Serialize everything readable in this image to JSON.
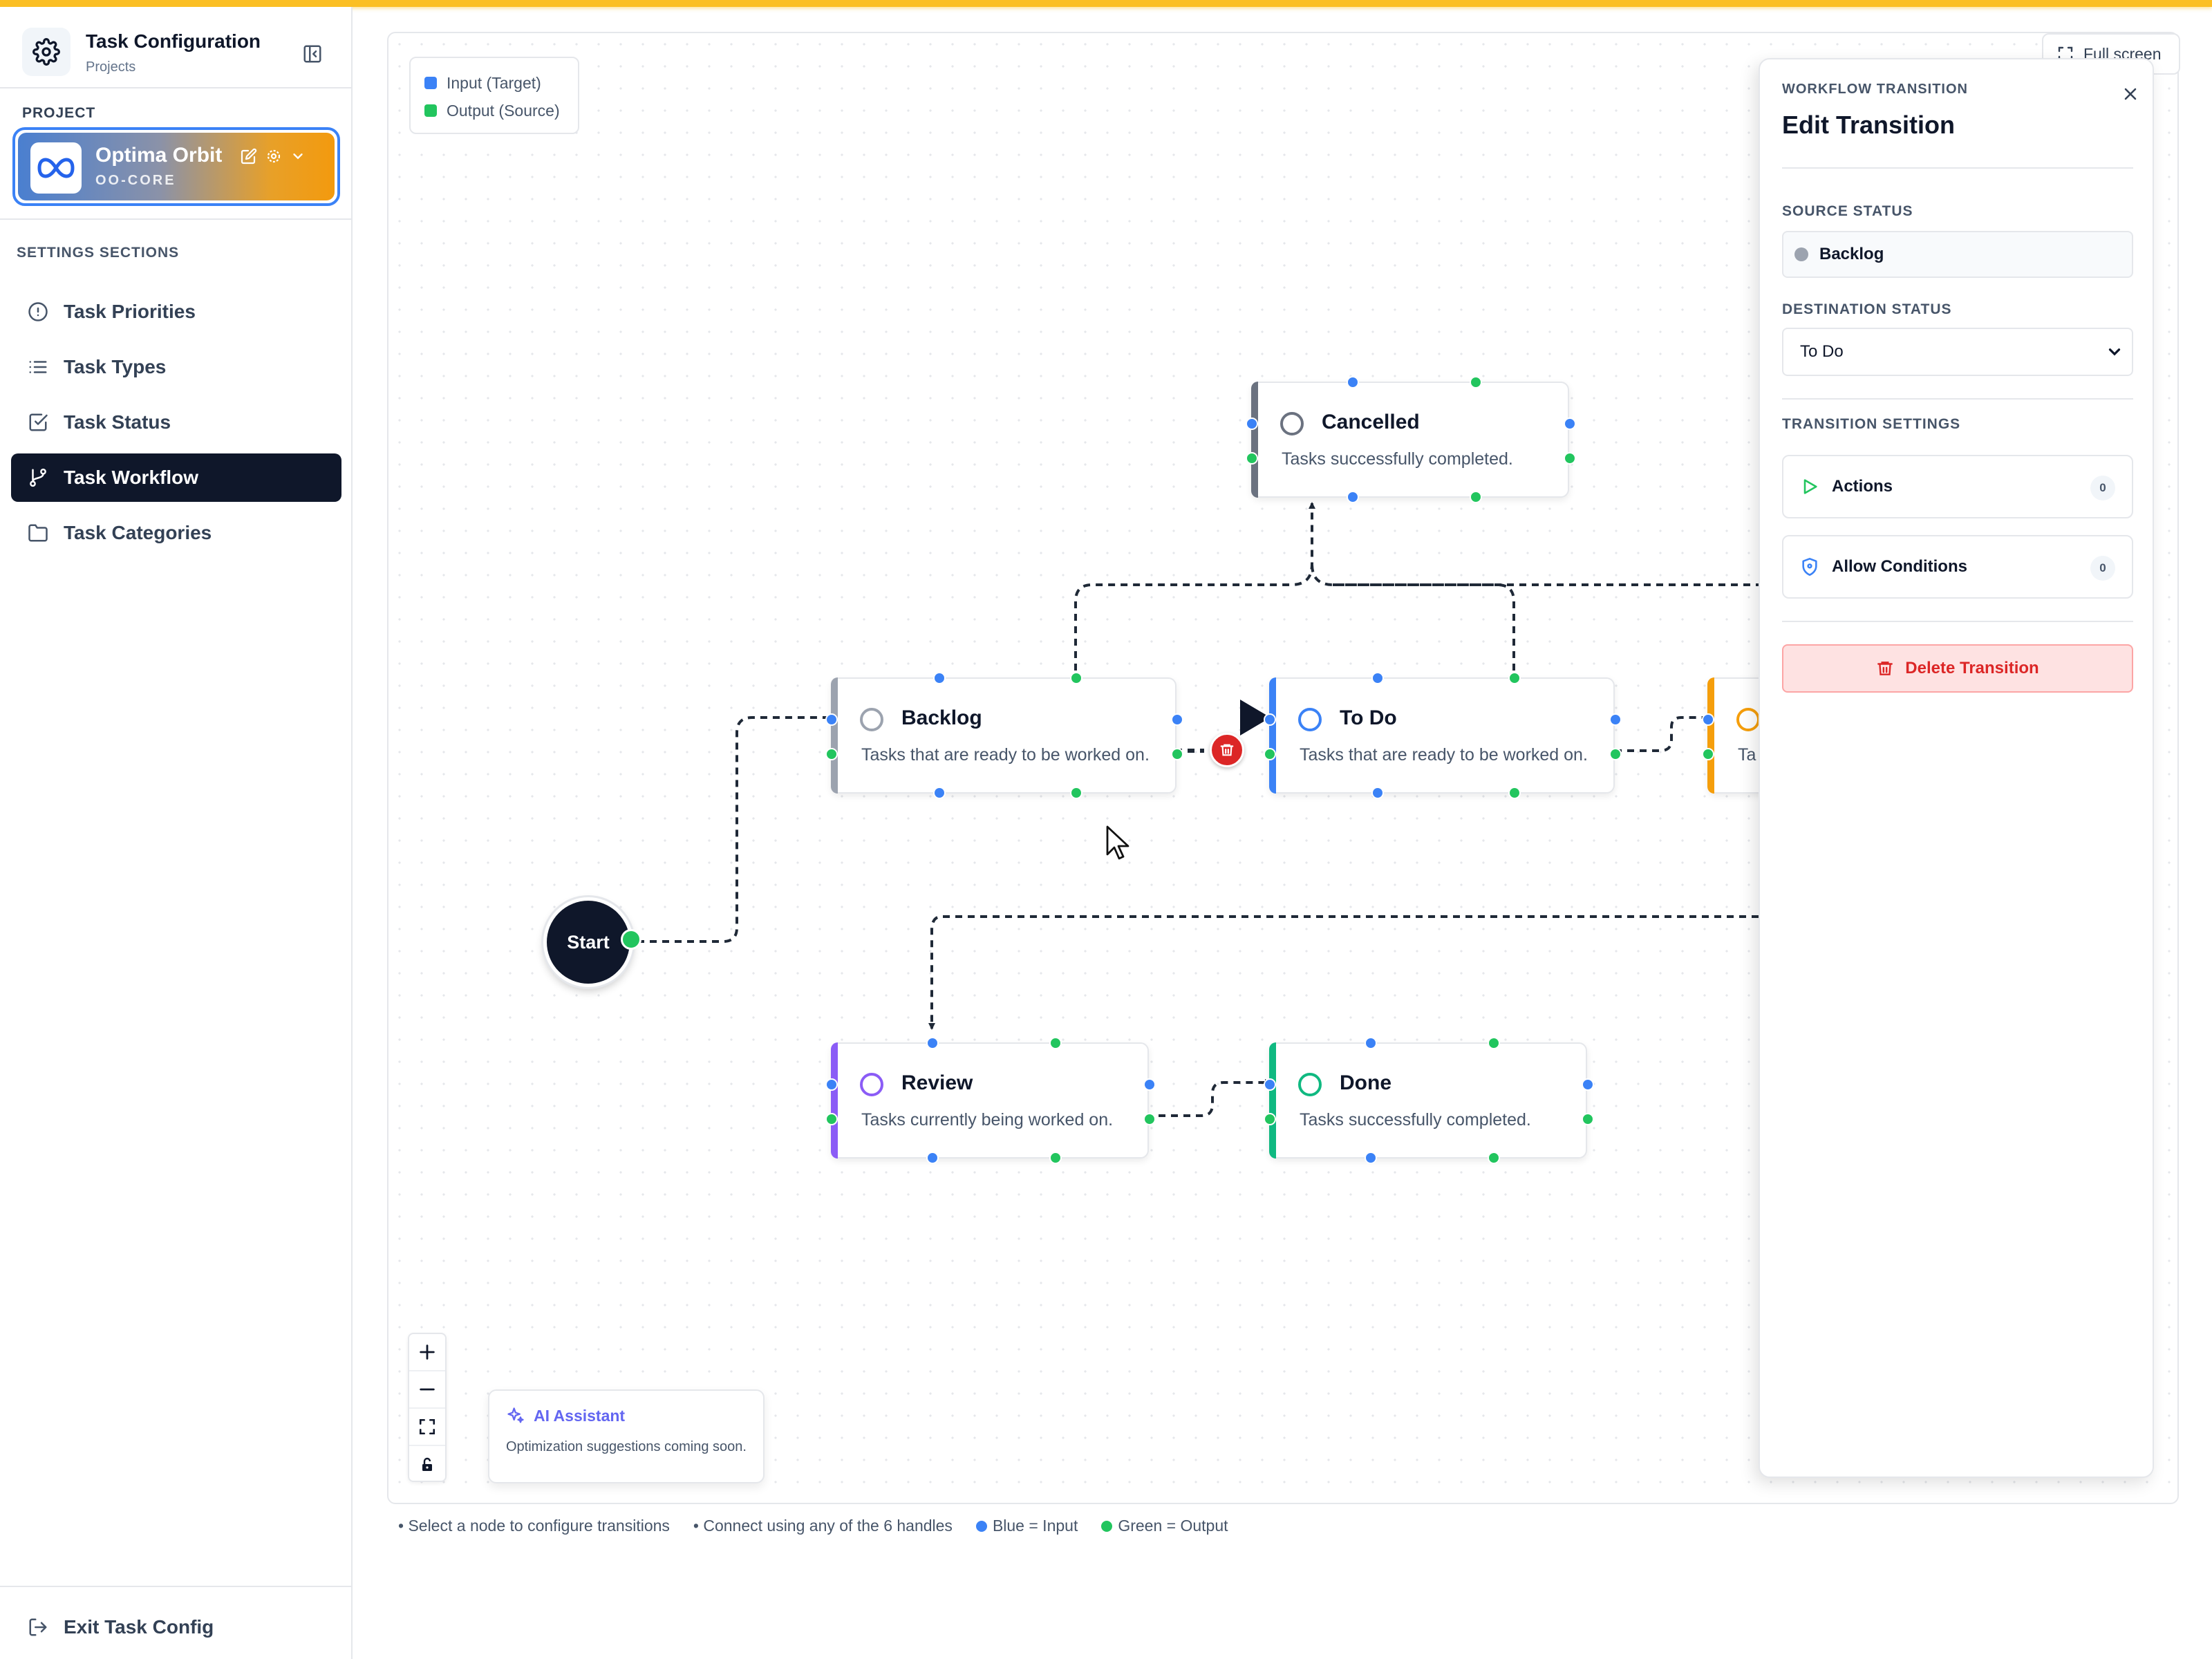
{
  "app": {
    "title": "Task Configuration",
    "subtitle": "Projects"
  },
  "sidebar": {
    "project_label": "PROJECT",
    "project": {
      "name": "Optima Orbit",
      "code": "OO-CORE"
    },
    "sections_label": "SETTINGS SECTIONS",
    "items": [
      {
        "label": "Task Priorities",
        "icon": "alert-circle-icon"
      },
      {
        "label": "Task Types",
        "icon": "list-icon"
      },
      {
        "label": "Task Status",
        "icon": "check-square-icon"
      },
      {
        "label": "Task Workflow",
        "icon": "git-branch-icon",
        "active": true
      },
      {
        "label": "Task Categories",
        "icon": "folder-icon"
      }
    ],
    "exit_label": "Exit Task Config"
  },
  "canvas": {
    "legend": {
      "input": "Input (Target)",
      "output": "Output (Source)"
    },
    "fullscreen_label": "Full screen",
    "start_label": "Start",
    "nodes": [
      {
        "id": "cancelled",
        "title": "Cancelled",
        "description": "Tasks successfully completed.",
        "color": "#6b7280"
      },
      {
        "id": "backlog",
        "title": "Backlog",
        "description": "Tasks that are ready to be worked on.",
        "color": "#9ca3af"
      },
      {
        "id": "todo",
        "title": "To Do",
        "description": "Tasks that are ready to be worked on.",
        "color": "#3b82f6"
      },
      {
        "id": "inprogress",
        "title": "",
        "description": "Ta",
        "color": "#f59e0b"
      },
      {
        "id": "review",
        "title": "Review",
        "description": "Tasks currently being worked on.",
        "color": "#8b5cf6"
      },
      {
        "id": "done",
        "title": "Done",
        "description": "Tasks successfully completed.",
        "color": "#10b981"
      }
    ],
    "ai": {
      "title": "AI Assistant",
      "subtitle": "Optimization suggestions coming soon."
    }
  },
  "hints": [
    "• Select a node to configure transitions",
    "• Connect using any of the 6 handles",
    "Blue = Input",
    "Green = Output"
  ],
  "panel": {
    "overline": "WORKFLOW TRANSITION",
    "title": "Edit Transition",
    "source_label": "SOURCE STATUS",
    "source_value": "Backlog",
    "destination_label": "DESTINATION STATUS",
    "destination_value": "To Do",
    "settings_label": "TRANSITION SETTINGS",
    "actions_label": "Actions",
    "actions_count": "0",
    "conditions_label": "Allow Conditions",
    "conditions_count": "0",
    "delete_label": "Delete Transition"
  },
  "colors": {
    "input": "#3b82f6",
    "output": "#22c55e",
    "danger": "#dc2626",
    "active_nav": "#0f172a"
  }
}
